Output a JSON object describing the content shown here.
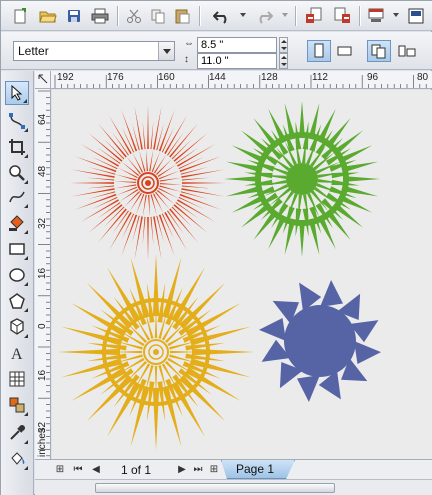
{
  "property_bar": {
    "page_size": "Letter",
    "width": "8.5 \"",
    "height": "11.0 \""
  },
  "rulers": {
    "top_labels": [
      "192",
      "176",
      "160",
      "144",
      "128",
      "112",
      "96",
      "80"
    ],
    "left_labels": [
      "64",
      "48",
      "32",
      "16",
      "0",
      "16",
      "32"
    ],
    "units": "inches"
  },
  "page_nav": {
    "counter": "1 of 1",
    "tab": "Page 1"
  },
  "artwork": [
    {
      "name": "red-starburst",
      "color": "#d8431c"
    },
    {
      "name": "green-starburst",
      "color": "#5aaa30"
    },
    {
      "name": "yellow-starburst",
      "color": "#e4ad1a"
    },
    {
      "name": "blue-starburst",
      "color": "#5664a6"
    }
  ],
  "icons": [
    "new-icon",
    "open-icon",
    "save-icon",
    "print-icon",
    "cut-icon",
    "copy-icon",
    "paste-icon",
    "undo-icon",
    "redo-icon",
    "import-icon",
    "export-icon",
    "publish-pdf-icon",
    "zoom-level-icon"
  ]
}
